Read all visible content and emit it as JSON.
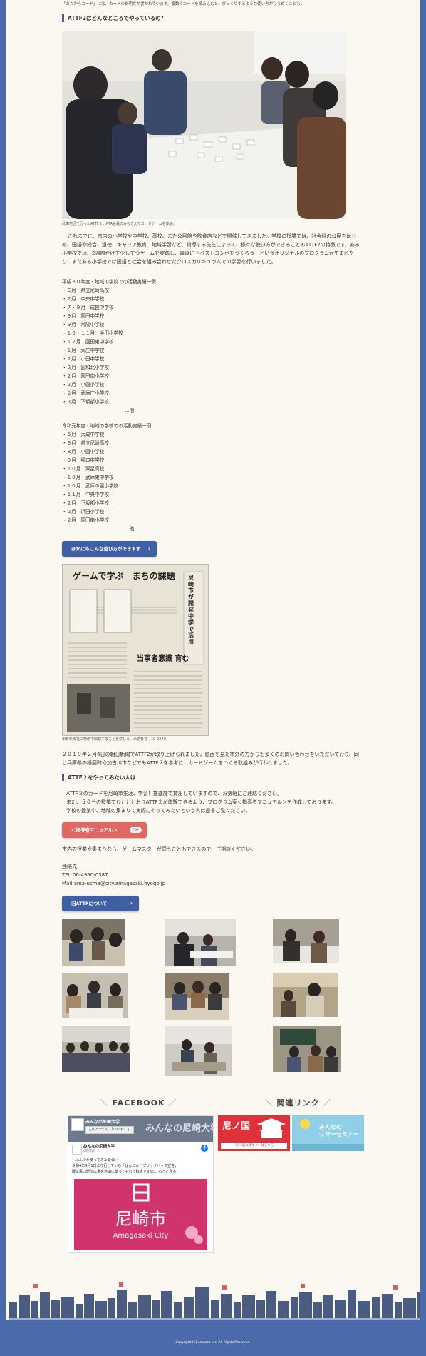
{
  "intro_text": "「おたからカード」には、カードの説明文が書かれています。複数のカードを読み込むと、びっくりするような使い方がひらめくことも。",
  "where_heading": "ATTF2はどんなところでやっているの？",
  "photo1_caption": "武庫地区で行ったATTF２。PTA役員のみなさんでカードゲームを体験。",
  "where_paragraph": "これまでに、市内の小学校や中学校、高校、また公民館や飲食店などで開催してきました。学校の授業では、社会科の公民をはじめ、国語や総合、道徳、キャリア教育、地域学習など、指導する先生によって、様々な使い方ができることもATTF2の特徴です。ある小学校では、2週間かけて少しずつゲームを実践し、最後に「ベストコンボをつくろう」というオリジナルのプログラムが生まれたり、またある小学校では国語と社会を組み合わせたクロスカリキュラムでの学習を行いました。",
  "list1_title": "平成３０年度・地域の学校での活動実績一例",
  "list1": [
    "・６月　県立尼崎高校",
    "・７月　中央中学校",
    "・７・９月　成良中学校",
    "・９月　園田中学校",
    "・９月　常陽中学校",
    "・１０・１１月　浜田小学校",
    "・１２月　園田東中学校",
    "・１月　大庄中学校",
    "・２月　小田中学校",
    "・２月　園和北小学校",
    "・２月　園田南小学校",
    "・２月　小園小学校",
    "・２月　武庫庄小学校",
    "・３月　下坂部小学校"
  ],
  "list1_etc": "…他",
  "list2_title": "令和元年度・地域の学校での活動実績一例",
  "list2": [
    "・５月　大成中学校",
    "・６月　県立尼崎高校",
    "・８月　小園中学校",
    "・９月　塚口中学校",
    "・１０月　双星高校",
    "・１０月　武庫東中学校",
    "・１０月　武庫の里小学校",
    "・１１月　中央中学校",
    "・２月　下坂部小学校",
    "・２月　浜田小学校",
    "・２月　園田南小学校"
  ],
  "list2_etc": "…他",
  "more_button": "ほかにもこんな遊び方ができます",
  "news_headline": "ゲームで学ぶ　まちの課題",
  "news_side": "尼崎市が開発　中学で活用",
  "news_sub": "当事者意識 育む",
  "news_caption": "朝日新聞社に無断で転載することを禁じる。承諾番号「19-2240」",
  "news_paragraph": "２０１９年２月6日の朝日新聞でATTF2が取り上げられました。紙面を見た市外の方からも多くのお問い合わせをいただいており、同じ兵庫県の播磨町や加古川市などでもATTF２を参考に、カードゲームをつくる取組みが行われました。",
  "try_heading": "ATTF２をやってみたい人は",
  "try_p1": "ATTF２のカードを尼崎市生涯、学習！推進課で貸出していますので、お気軽にご連絡ください。",
  "try_p2": "また、５０分の授業でひとととおりATTF２が体験できるよう、プログラム案＜指導者マニュアル＞を作成しております。",
  "try_p3": "学校の授業や、地域の集まりで実際にやってみたいという人は是非ご覧ください。",
  "manual_button": "＜指導者マニュアル＞",
  "pdf_badge": "PDF",
  "contact_note": "市内の授業や集まりなら、ゲームマスターが伺うこともできるので、ご相談ください。",
  "contact_label": "連絡先",
  "contact_tel": "TEL:06-4950-0387",
  "contact_mail": "Mail:ama-ucma@city.amagasaki.hyogo.jp",
  "about_button": "旧ATTFについて",
  "facebook_title": "FACEBOOK",
  "related_title": "関連リンク",
  "fb_page_name": "みんなの尼崎大学",
  "fb_cover_text": "みんなの尼崎大学",
  "fb_like": "このページに「いいね！」",
  "fb_post_name": "みんなの尼崎大学",
  "fb_post_time": "6時間前",
  "fb_post_text1": "＼はんつか使ってみた😊😊／",
  "fb_post_text2": "令和4年4月1日より行っている「はんつかパブリックハック宣言」",
  "fb_post_text3": "阪急塚口駅前広場を自由に使ってもらう取組です😊… もっと見る",
  "fb_city_jp": "尼崎市",
  "fb_city_en": "Amagasaki City",
  "banner1_text": "尼ノ国",
  "banner1_sub": "尼ノ国公式サイトはこちら",
  "banner2_text": "みんなの\nサマーセミナー",
  "copyright": "Copyright (C) amacoo Inc. All Rights Reserved.",
  "colors": {
    "navy": "#3f5ea3",
    "red": "#e06863",
    "cream": "#fbf8f1"
  }
}
